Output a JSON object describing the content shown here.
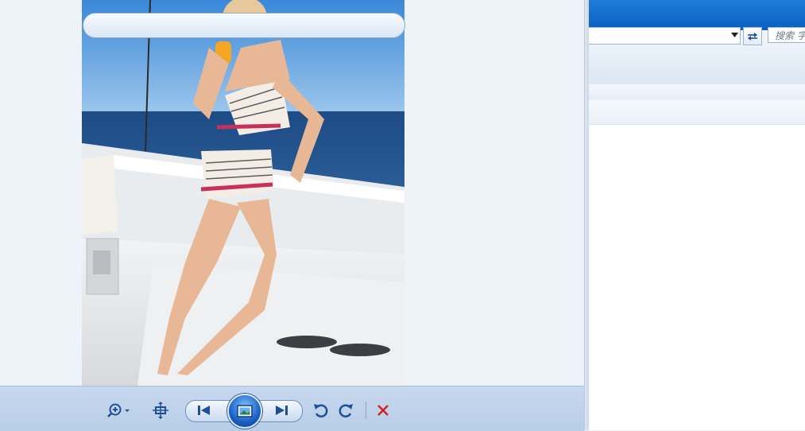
{
  "viewer": {
    "photo": {
      "description_icon": "photo-icon"
    },
    "toolbar": {
      "zoom": {
        "icon": "zoom-in-icon"
      },
      "fit": {
        "icon": "actual-size-icon"
      },
      "previous": {
        "icon": "previous-icon"
      },
      "slideshow": {
        "icon": "slideshow-icon"
      },
      "next": {
        "icon": "next-icon"
      },
      "rotate_ccw": {
        "icon": "rotate-counterclockwise-icon"
      },
      "rotate_cw": {
        "icon": "rotate-clockwise-icon"
      },
      "delete": {
        "icon": "delete-icon"
      }
    }
  },
  "explorer": {
    "search": {
      "placeholder": "搜索 字"
    },
    "refresh": {
      "icon": "refresh-icon"
    },
    "address_dropdown": {
      "icon": "chevron-down-icon"
    }
  },
  "colors": {
    "title_bar": "#0a5fc2",
    "toolbar_bg": "#c7d8ee",
    "delete_red": "#d42020",
    "icon_blue": "#1d4f95"
  }
}
